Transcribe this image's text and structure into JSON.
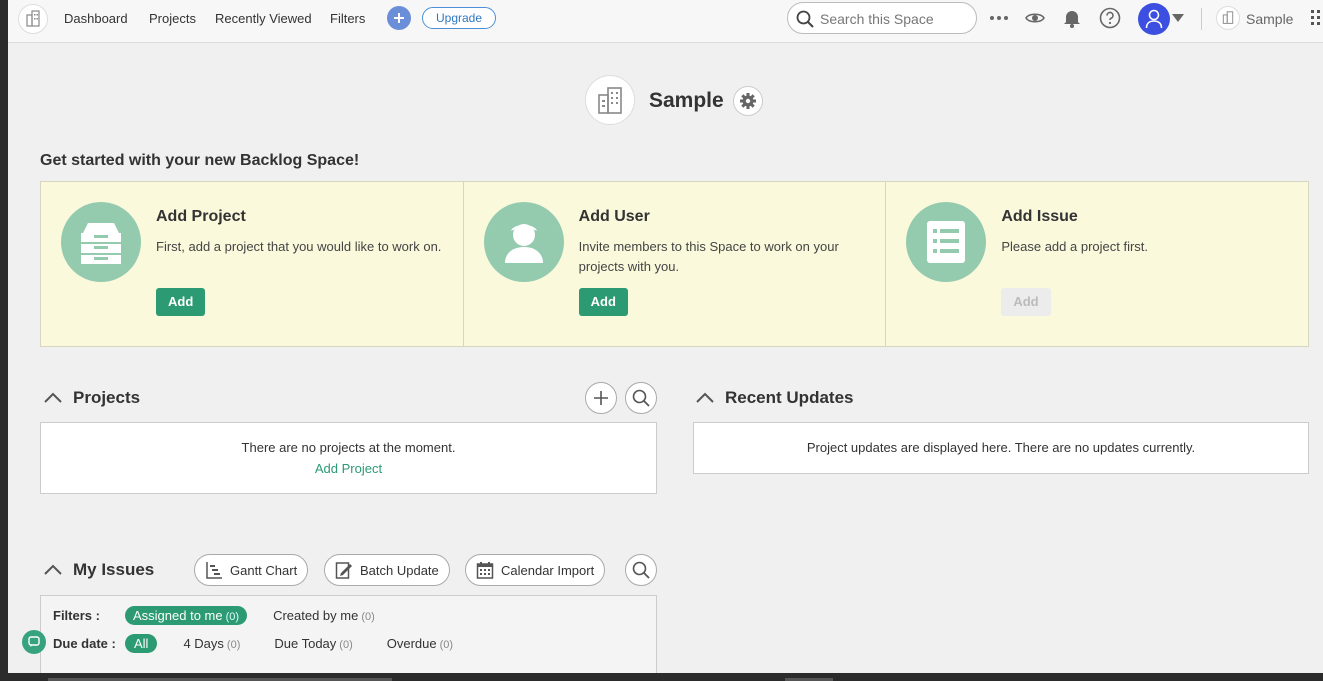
{
  "header": {
    "nav": [
      "Dashboard",
      "Projects",
      "Recently Viewed",
      "Filters"
    ],
    "upgrade_label": "Upgrade",
    "search_placeholder": "Search this Space",
    "space_name": "Sample"
  },
  "space": {
    "title": "Sample"
  },
  "get_started": {
    "heading": "Get started with your new Backlog Space!",
    "cards": [
      {
        "title": "Add Project",
        "desc": "First, add a project that you would like to work on.",
        "button": "Add",
        "enabled": true,
        "icon": "archive-box-icon"
      },
      {
        "title": "Add User",
        "desc": "Invite members to this Space to work on your projects with you.",
        "button": "Add",
        "enabled": true,
        "icon": "user-icon"
      },
      {
        "title": "Add Issue",
        "desc": "Please add a project first.",
        "button": "Add",
        "enabled": false,
        "icon": "list-icon"
      }
    ]
  },
  "projects": {
    "title": "Projects",
    "empty_text": "There are no projects at the moment.",
    "add_link": "Add Project"
  },
  "recent_updates": {
    "title": "Recent Updates",
    "empty_text": "Project updates are displayed here. There are no updates currently."
  },
  "my_issues": {
    "title": "My Issues",
    "buttons": [
      "Gantt Chart",
      "Batch Update",
      "Calendar Import"
    ],
    "filters_label": "Filters :",
    "filters": [
      {
        "label": "Assigned to me",
        "count": "(0)",
        "active": true
      },
      {
        "label": "Created by me",
        "count": "(0)",
        "active": false
      }
    ],
    "due_label": "Due date :",
    "due": [
      {
        "label": "All",
        "count": "",
        "active": true
      },
      {
        "label": "4 Days",
        "count": "(0)",
        "active": false
      },
      {
        "label": "Due Today",
        "count": "(0)",
        "active": false
      },
      {
        "label": "Overdue",
        "count": "(0)",
        "active": false
      }
    ]
  },
  "colors": {
    "accent": "#2c9a73",
    "card_bg": "#fbf9dc",
    "icon_circle": "#94cbaf",
    "avatar": "#3d4fe0"
  }
}
